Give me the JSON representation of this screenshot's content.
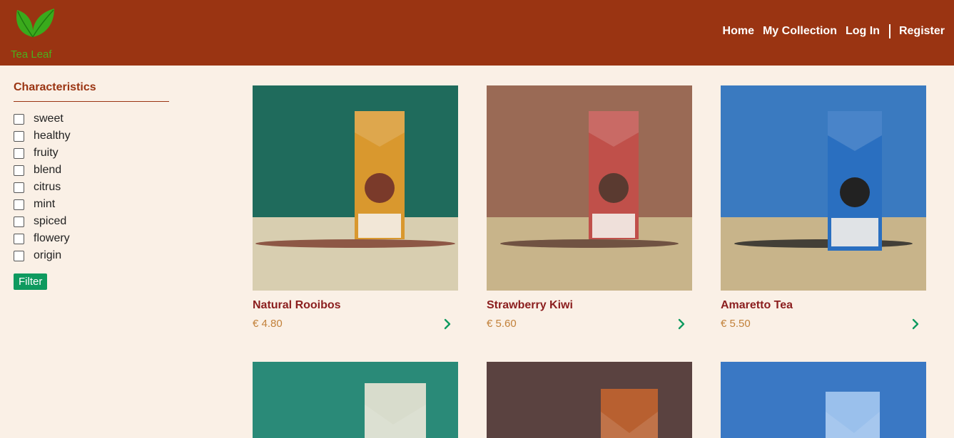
{
  "brand": {
    "name": "Tea Leaf",
    "logo_icon": "tea-leaves-icon"
  },
  "nav": [
    {
      "label": "Home"
    },
    {
      "label": "My Collection"
    },
    {
      "label": "Log In"
    },
    {
      "label": "Register"
    }
  ],
  "filters": {
    "title": "Characteristics",
    "items": [
      {
        "label": "sweet",
        "checked": false
      },
      {
        "label": "healthy",
        "checked": false
      },
      {
        "label": "fruity",
        "checked": false
      },
      {
        "label": "blend",
        "checked": false
      },
      {
        "label": "citrus",
        "checked": false
      },
      {
        "label": "mint",
        "checked": false
      },
      {
        "label": "spiced",
        "checked": false
      },
      {
        "label": "flowery",
        "checked": false
      },
      {
        "label": "origin",
        "checked": false
      }
    ],
    "button_label": "Filter"
  },
  "products": [
    {
      "name": "Natural Rooibos",
      "price": "€ 4.80",
      "bg": "#1f6b5c",
      "floor": "#d8ceb0",
      "bag": "#d9982e",
      "leaves": "#7a3a2a"
    },
    {
      "name": "Strawberry Kiwi",
      "price": "€ 5.60",
      "bg": "#9a6a55",
      "floor": "#c8b48a",
      "bag": "#c0504a",
      "leaves": "#5a3a30"
    },
    {
      "name": "Amaretto Tea",
      "price": "€ 5.50",
      "bg": "#3a7ac0",
      "floor": "#c8b48a",
      "bag": "#2a6fc0",
      "leaves": "#222222"
    },
    {
      "name": "",
      "price": "",
      "bg": "#2a8a78",
      "floor": "",
      "bag": "#d8dccc",
      "leaves": ""
    },
    {
      "name": "",
      "price": "",
      "bg": "#5a4240",
      "floor": "",
      "bag": "#b86030",
      "leaves": ""
    },
    {
      "name": "",
      "price": "",
      "bg": "#3a78c4",
      "floor": "",
      "bag": "#9ac0ec",
      "leaves": ""
    }
  ],
  "colors": {
    "header": "#9a3412",
    "accent": "#0e9a5f",
    "page_bg": "#faf0e6"
  }
}
